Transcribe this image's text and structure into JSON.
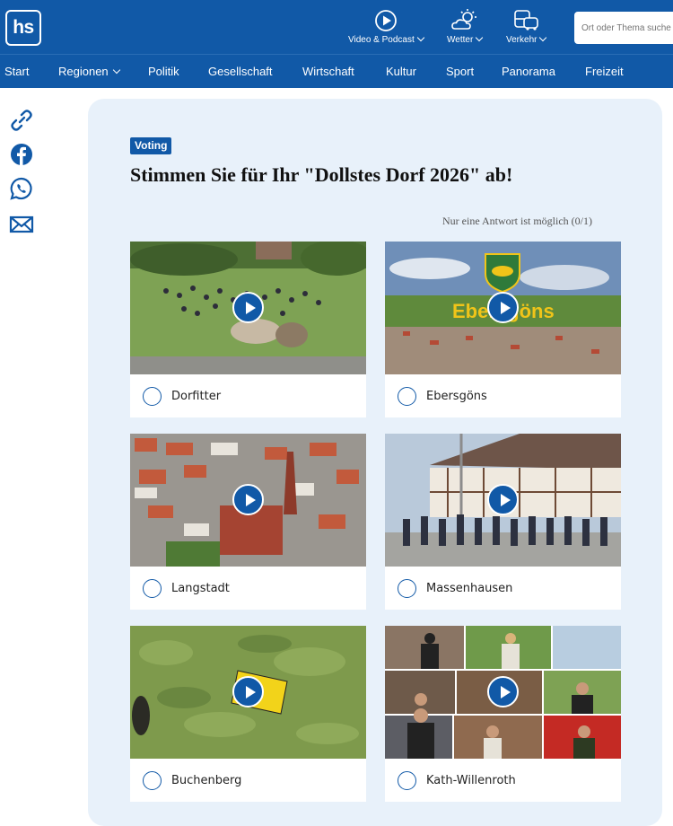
{
  "header": {
    "logo": "hs",
    "items": [
      {
        "label": "Video & Podcast",
        "icon": "play-circle-icon"
      },
      {
        "label": "Wetter",
        "icon": "weather-icon"
      },
      {
        "label": "Verkehr",
        "icon": "traffic-icon"
      }
    ],
    "search_placeholder": "Ort oder Thema suche"
  },
  "nav": {
    "items": [
      "Start",
      "Regionen",
      "Politik",
      "Gesellschaft",
      "Wirtschaft",
      "Kultur",
      "Sport",
      "Panorama",
      "Freizeit"
    ]
  },
  "share": [
    "link-icon",
    "facebook-icon",
    "whatsapp-icon",
    "mail-icon"
  ],
  "voting": {
    "badge": "Voting",
    "title": "Stimmen Sie für Ihr \"Dollstes Dorf 2026\" ab!",
    "hint": "Nur eine Antwort ist möglich (0/1)",
    "options": [
      {
        "label": "Dorfitter"
      },
      {
        "label": "Ebersgöns",
        "overlay_text": "Ebersgöns"
      },
      {
        "label": "Langstadt"
      },
      {
        "label": "Massenhausen"
      },
      {
        "label": "Buchenberg"
      },
      {
        "label": "Kath-Willenroth"
      }
    ]
  },
  "colors": {
    "brand": "#1159a7",
    "panel": "#e8f1fa"
  }
}
